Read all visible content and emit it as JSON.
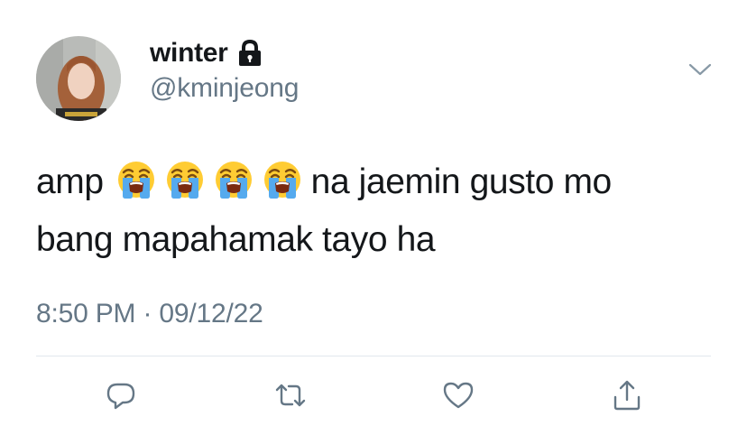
{
  "user": {
    "display_name": "winter",
    "handle": "@kminjeong",
    "protected": true
  },
  "tweet": {
    "text_line1_start": "amp",
    "emoji": [
      "loudly-crying-face",
      "loudly-crying-face",
      "loudly-crying-face",
      "loudly-crying-face"
    ],
    "text_line1_end": "na jaemin gusto mo",
    "text_line2": "bang mapahamak tayo ha",
    "timestamp": "8:50 PM · 09/12/22"
  },
  "actions": [
    {
      "icon": "reply-icon"
    },
    {
      "icon": "retweet-icon"
    },
    {
      "icon": "like-icon"
    },
    {
      "icon": "share-icon"
    }
  ],
  "colors": {
    "text": "#14171a",
    "secondary": "#657786",
    "divider": "#e1e8ed"
  }
}
